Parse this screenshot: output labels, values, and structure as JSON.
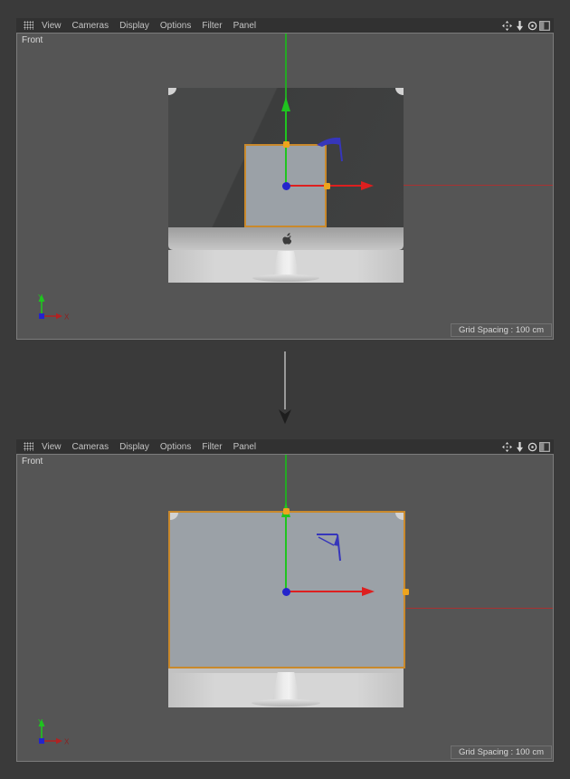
{
  "menu": {
    "items": [
      "View",
      "Cameras",
      "Display",
      "Options",
      "Filter",
      "Panel"
    ]
  },
  "icons": {
    "menu_grid": "grid-dots-icon",
    "pan": "pan-icon",
    "dolly": "dolly-icon",
    "rotate": "rotate-icon",
    "layout": "layout-toggle-icon",
    "apple_logo": "apple-logo-icon",
    "transition": "down-arrow"
  },
  "panels": [
    {
      "view_label": "Front",
      "grid_spacing": "Grid Spacing : 100 cm"
    },
    {
      "view_label": "Front",
      "grid_spacing": "Grid Spacing : 100 cm"
    }
  ],
  "axis": {
    "y_label": "Y",
    "x_label": "X"
  },
  "colors": {
    "outer-bg": "#3a3a3a",
    "menubar-bg": "#313131",
    "menu-text": "#c3c3c3",
    "viewport-bg": "#555555",
    "label-text": "#d8d8d8",
    "badge-bg": "#585858",
    "badge-border": "#717171",
    "plane-fill": "#9ba1a7",
    "selection-orange": "#c9892c",
    "gizmo-green": "#1fc41f",
    "gizmo-red": "#dd1f1f",
    "gizmo-blue": "#2424cc",
    "handle-orange": "#eda41d",
    "world-red": "#a83232",
    "world-green": "#24a824",
    "z-blue": "#3636bb",
    "backdrop": "#d2d2d2",
    "arrow-line": "#9a9a9a",
    "arrow-head": "#1e1e1e"
  }
}
